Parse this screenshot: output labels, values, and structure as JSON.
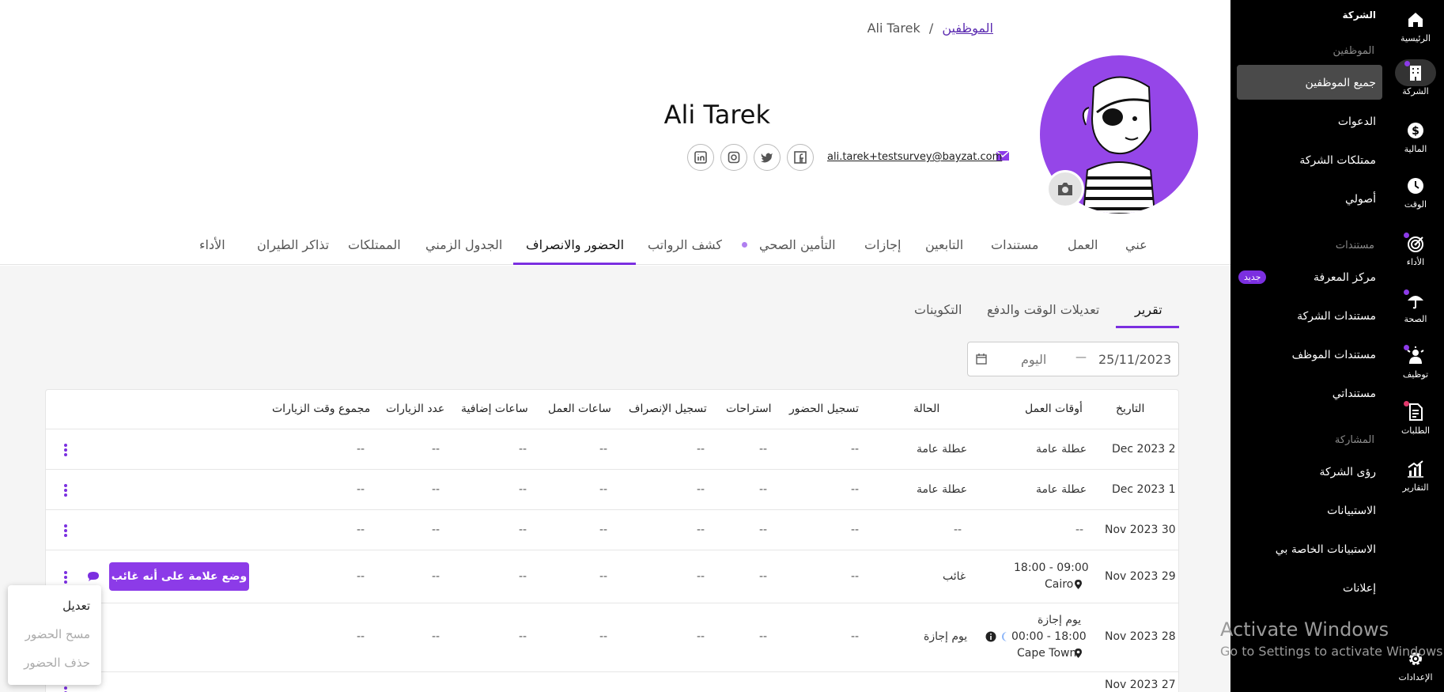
{
  "breadcrumb": {
    "link": "الموظفين",
    "separator": "/",
    "current": "Ali Tarek"
  },
  "profile": {
    "name": "Ali Tarek",
    "email": "ali.tarek+testsurvey@bayzat.com"
  },
  "tabs": [
    {
      "label": "عني"
    },
    {
      "label": "العمل"
    },
    {
      "label": "مستندات"
    },
    {
      "label": "التابعين"
    },
    {
      "label": "إجازات"
    },
    {
      "label": "التأمين الصحي"
    },
    {
      "label": "كشف الرواتب"
    },
    {
      "label": "الحضور والانصراف"
    },
    {
      "label": "الجدول الزمني"
    },
    {
      "label": "الممتلكات"
    },
    {
      "label": "تذاكر الطيران"
    },
    {
      "label": "الأداء"
    }
  ],
  "subtabs": [
    {
      "label": "تقرير"
    },
    {
      "label": "تعديلات الوقت والدفع"
    },
    {
      "label": "التكوينات"
    }
  ],
  "date_range": {
    "start": "25/11/2023",
    "end": "اليوم",
    "separator": "—"
  },
  "table": {
    "headers": [
      "التاريخ",
      "أوقات العمل",
      "الحالة",
      "تسجيل الحضور",
      "استراحات",
      "تسجيل الإنصراف",
      "ساعات العمل",
      "ساعات إضافية",
      "عدد الزيارات",
      "مجموع وقت الزيارات"
    ],
    "rows": [
      {
        "date": "Dec 2023 2",
        "work": "عطلة عامة",
        "status": "عطلة عامة",
        "cells": [
          "--",
          "--",
          "--",
          "--",
          "--",
          "--",
          "--"
        ]
      },
      {
        "date": "Dec 2023 1",
        "work": "عطلة عامة",
        "status": "عطلة عامة",
        "cells": [
          "--",
          "--",
          "--",
          "--",
          "--",
          "--",
          "--"
        ]
      },
      {
        "date": "Nov 2023 30",
        "work": "--",
        "status": "--",
        "cells": [
          "--",
          "--",
          "--",
          "--",
          "--",
          "--",
          "--"
        ]
      },
      {
        "date": "Nov 2023 29",
        "work": "18:00 - 09:00",
        "location": "Cairo",
        "status": "غائب",
        "cells": [
          "--",
          "--",
          "--",
          "--",
          "--",
          "--",
          "--"
        ],
        "action": "وضع علامة على أنه غائب"
      },
      {
        "date": "Nov 2023 28",
        "work_title": "يوم إجازة",
        "work": "00:00 - 18:00",
        "location": "Cape Town",
        "status": "يوم إجازة",
        "cells": [
          "--",
          "--",
          "--",
          "--",
          "--",
          "--",
          "--"
        ]
      },
      {
        "date": "Nov 2023 27"
      }
    ]
  },
  "row_menu": {
    "edit": "تعديل",
    "clear": "مسح الحضور",
    "delete": "حذف الحضور"
  },
  "nav": {
    "company_header": "الشركة",
    "employees_section": "الموظفين",
    "all_employees": "جميع الموظفين",
    "invitations": "الدعوات",
    "company_assets": "ممتلكات الشركة",
    "my_assets": "أصولي",
    "documents_section": "مستندات",
    "knowledge_center": "مركز المعرفة",
    "new_badge": "جديد",
    "company_documents": "مستندات الشركة",
    "employee_documents": "مستندات الموظف",
    "my_documents": "مستنداتي",
    "engagement_section": "المشاركة",
    "company_insights": "رؤى الشركة",
    "surveys": "الاستبيانات",
    "my_surveys": "الاستبيانات الخاصة بي",
    "announcements": "إعلانات"
  },
  "rail": {
    "home": "الرئيسية",
    "company": "الشركة",
    "finance": "المالية",
    "time": "الوقت",
    "performance": "الأداء",
    "health": "الصحة",
    "hiring": "توظيف",
    "requests": "الطلبات",
    "reports": "التقارير",
    "settings": "الإعدادات"
  },
  "watermark": {
    "line1": "Activate Windows",
    "line2": "Go to Settings to activate Windows."
  },
  "colors": {
    "accent": "#7b2fe0",
    "avatar_bg": "#9546e8",
    "sidebar": "#000000"
  }
}
